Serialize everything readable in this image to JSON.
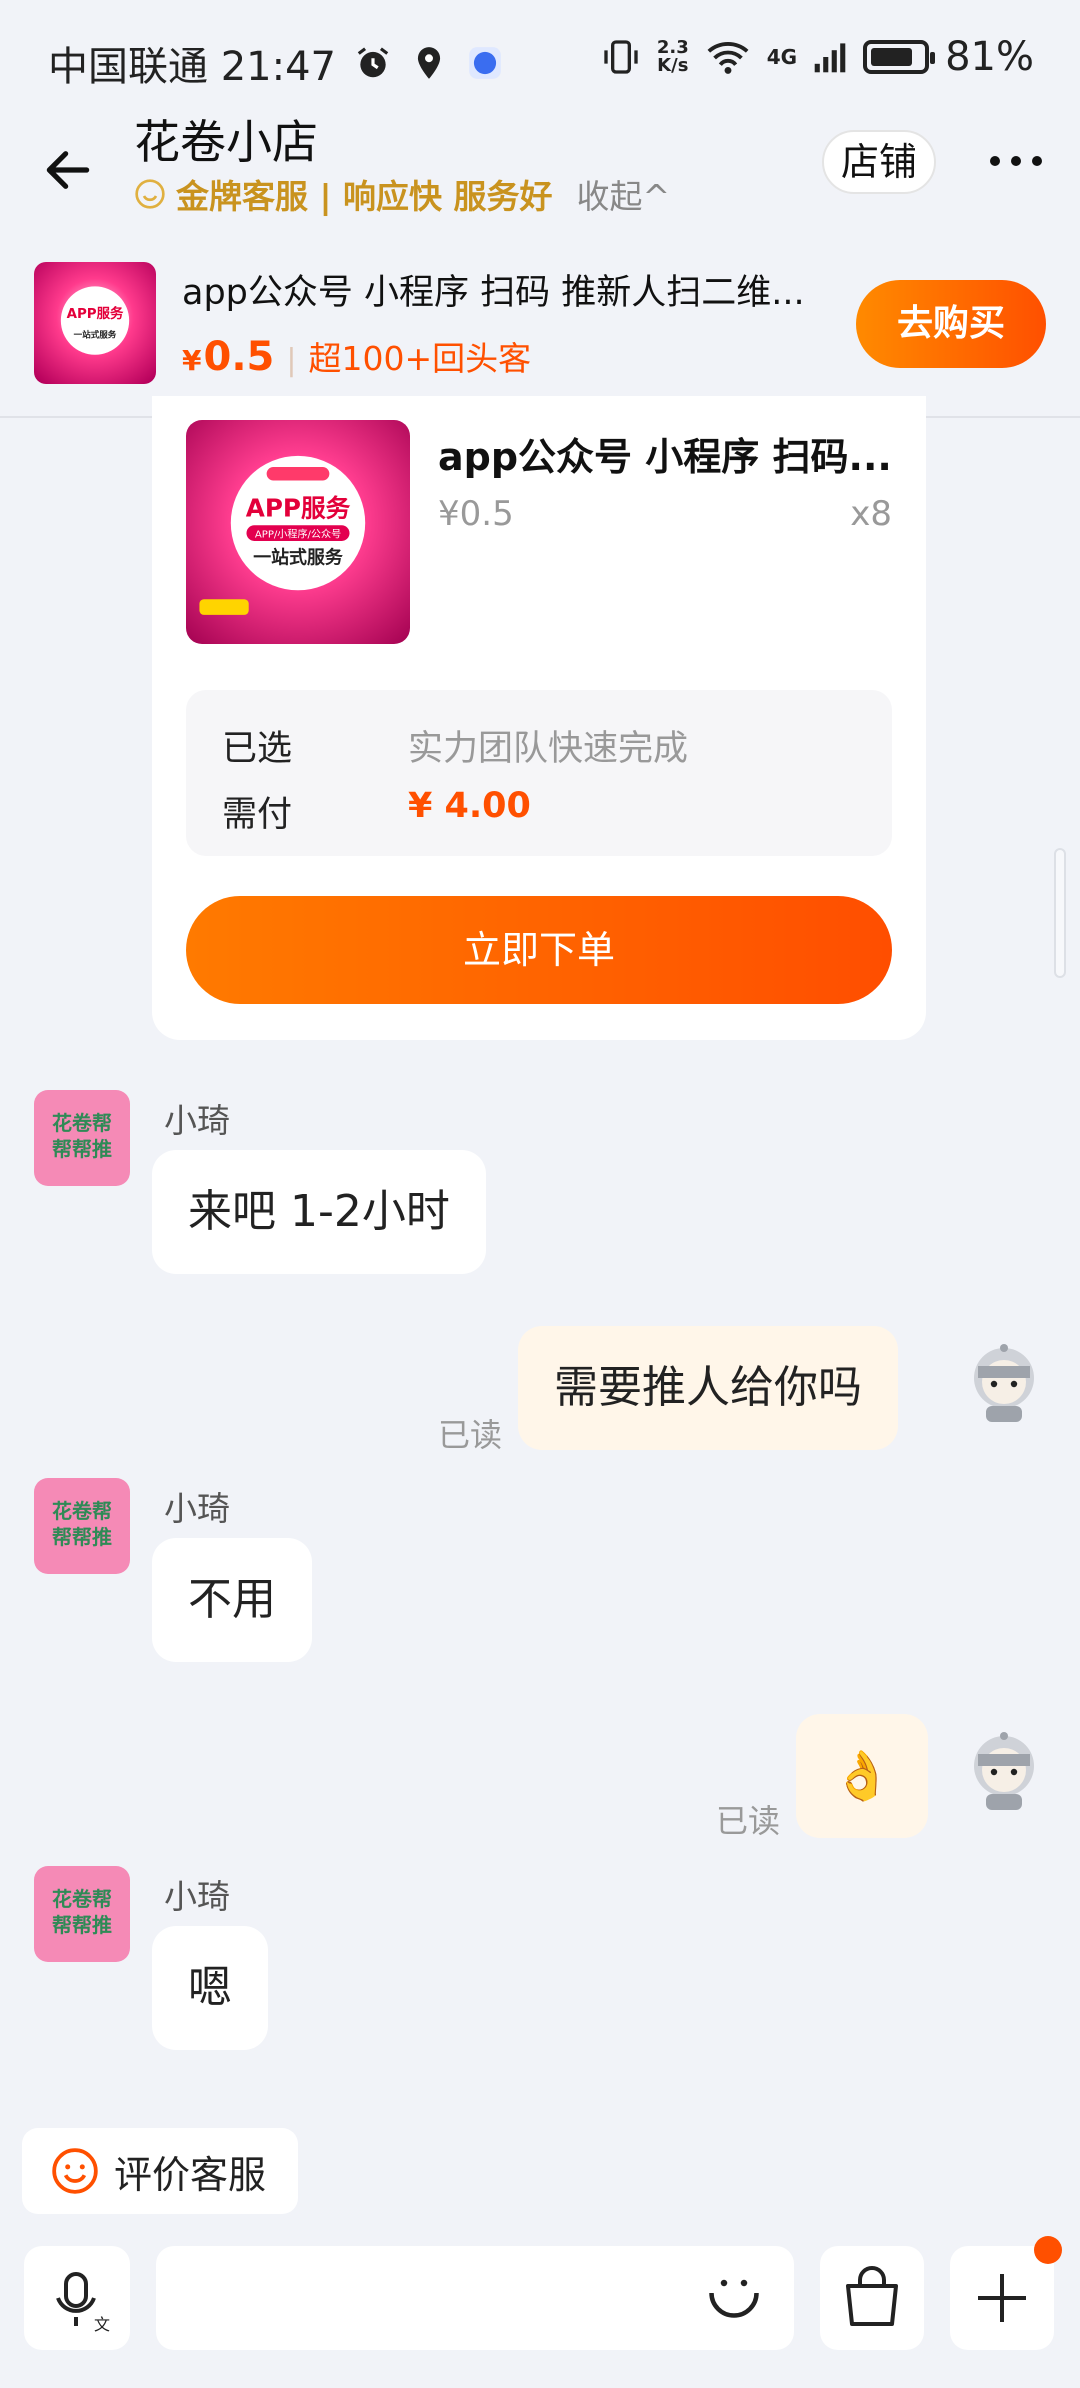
{
  "status_bar": {
    "carrier_time": "中国联通 21:47",
    "net_speed_top": "2.3",
    "net_speed_unit": "K/s",
    "signal": "4G",
    "battery": "81%",
    "battery_level": 0.81
  },
  "header": {
    "title": "花卷小店",
    "badge": "金牌客服 | 响应快 服务好",
    "collapse": "收起^",
    "store_button": "店铺"
  },
  "product_bar": {
    "title": "app公众号 小程序 扫码 推新人扫二维...",
    "price_symbol": "¥",
    "price": "0.5",
    "repeat_customers": "超100+回头客",
    "buy_button": "去购买"
  },
  "order_card": {
    "title": "app公众号 小程序 扫码...",
    "price": "¥0.5",
    "quantity": "x8",
    "thumb_text": "APP服务",
    "thumb_sub": "APP/小程序/公众号",
    "thumb_sub2": "一站式服务",
    "selected_label": "已选",
    "selected_value": "实力团队快速完成",
    "pay_label": "需付",
    "pay_value": "¥ 4.00",
    "order_button": "立即下单"
  },
  "messages": [
    {
      "sender": "小琦",
      "text": "来吧 1-2小时"
    },
    {
      "text": "需要推人给你吗",
      "read": "已读"
    },
    {
      "sender": "小琦",
      "text": "不用"
    },
    {
      "text": "👌",
      "read": "已读"
    },
    {
      "sender": "小琦",
      "text": "嗯"
    }
  ],
  "shop_avatar_text": "花卷帮 帮帮推",
  "rate_button": "评价客服",
  "colors": {
    "accent": "#ff5000",
    "gold": "#c9931f",
    "background": "#f1f3f8",
    "self_bubble": "#fff6e9"
  }
}
